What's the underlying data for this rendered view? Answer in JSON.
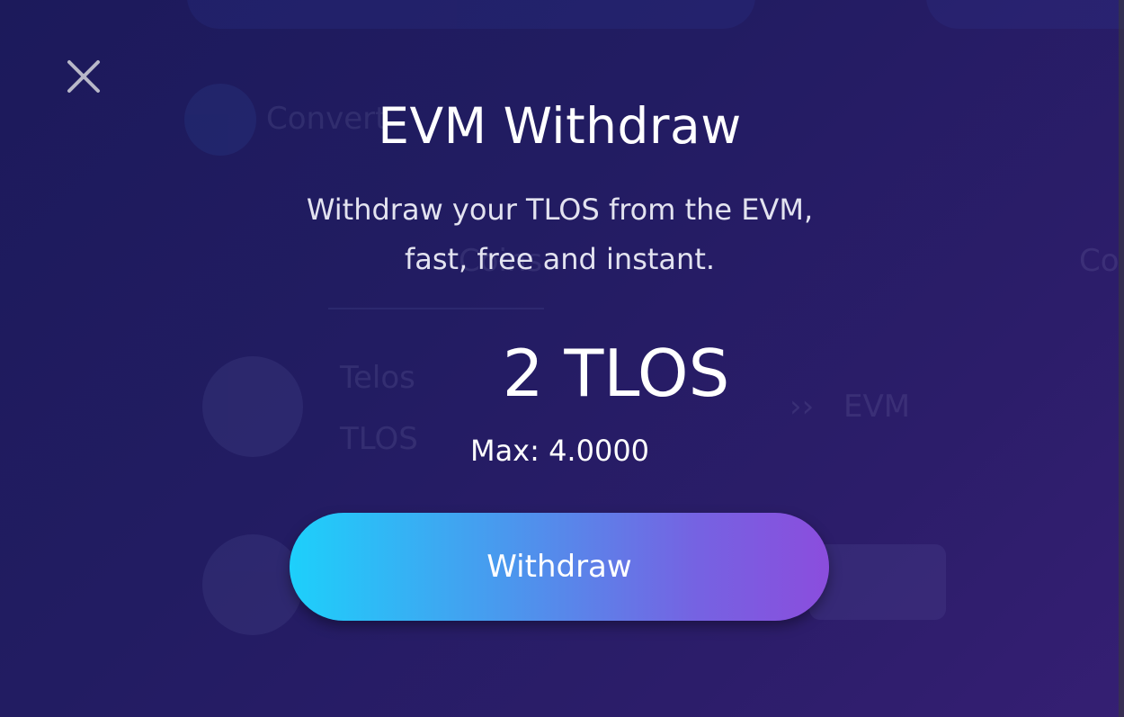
{
  "modal": {
    "title": "EVM Withdraw",
    "subtitle_line1": "Withdraw your TLOS from the EVM,",
    "subtitle_line2": "fast, free and instant.",
    "amount_value": "2 TLOS",
    "max_label": "Max: 4.0000",
    "withdraw_button_label": "Withdraw",
    "close_icon": "close-icon"
  },
  "background": {
    "convert_label": "Convert",
    "coins_label": "Coins",
    "token_name": "Telos",
    "token_symbol": "TLOS",
    "evm_label": "EVM",
    "right_label": "Co"
  },
  "colors": {
    "background_start": "#1c1a5b",
    "background_end": "#351f73",
    "button_gradient_start": "#1dd0fb",
    "button_gradient_end": "#8b4ddd",
    "text": "#ffffff"
  }
}
